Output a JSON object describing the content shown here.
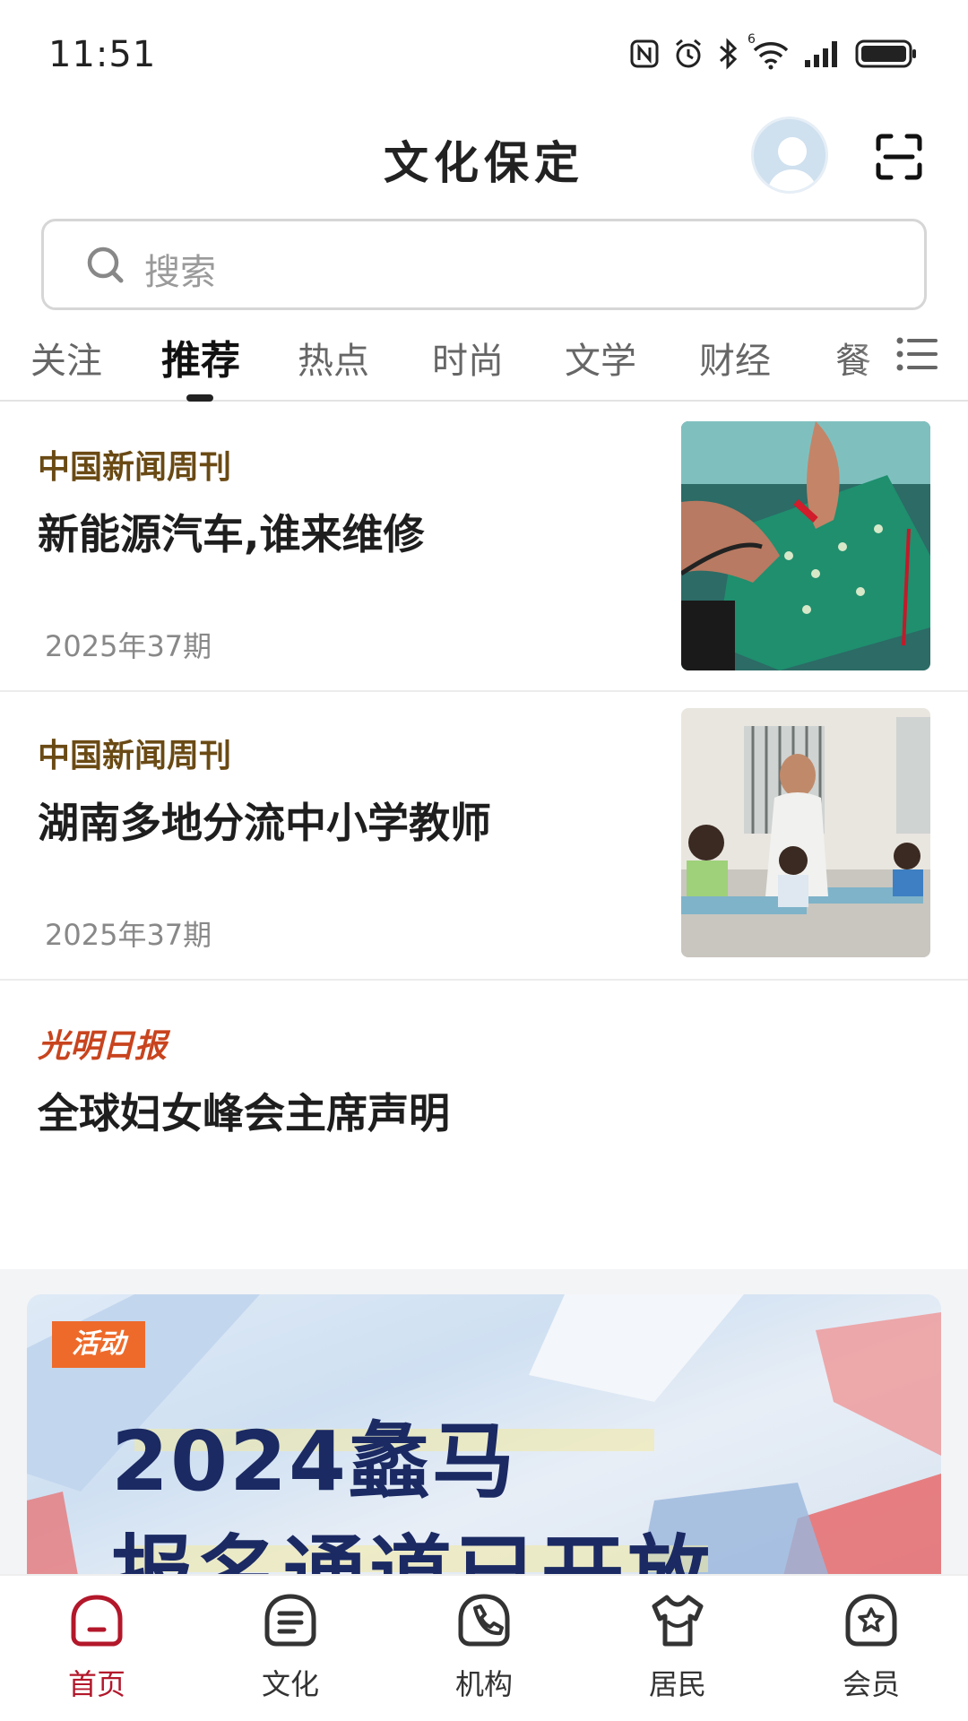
{
  "status_bar": {
    "time": "11:51",
    "wifi_badge": "6"
  },
  "header": {
    "title": "文化保定"
  },
  "search": {
    "placeholder": "搜索"
  },
  "tabs": [
    {
      "label": "关注"
    },
    {
      "label": "推荐",
      "active": true
    },
    {
      "label": "热点"
    },
    {
      "label": "时尚"
    },
    {
      "label": "文学"
    },
    {
      "label": "财经"
    },
    {
      "label": "餐"
    }
  ],
  "feed": [
    {
      "source": "中国新闻周刊",
      "title": "新能源汽车,谁来维修",
      "meta": "2025年37期",
      "thumb": "circuit-board-repair-photo"
    },
    {
      "source": "中国新闻周刊",
      "title": "湖南多地分流中小学教师",
      "meta": "2025年37期",
      "thumb": "classroom-teacher-photo"
    },
    {
      "source": "光明日报",
      "title": "全球妇女峰会主席声明"
    }
  ],
  "banner": {
    "badge": "活动",
    "line1": "2024蠡马",
    "line2": "报名通道已开放"
  },
  "bottom_nav": [
    {
      "label": "首页",
      "icon": "home-icon",
      "active": true
    },
    {
      "label": "文化",
      "icon": "document-icon"
    },
    {
      "label": "机构",
      "icon": "phone-icon"
    },
    {
      "label": "居民",
      "icon": "shirt-icon"
    },
    {
      "label": "会员",
      "icon": "star-badge-icon"
    }
  ],
  "colors": {
    "accent": "#b3172a",
    "source_brown": "#6a4a14",
    "source_red": "#c8441e",
    "banner_badge": "#ee6a2b",
    "banner_text": "#1b2a63"
  }
}
